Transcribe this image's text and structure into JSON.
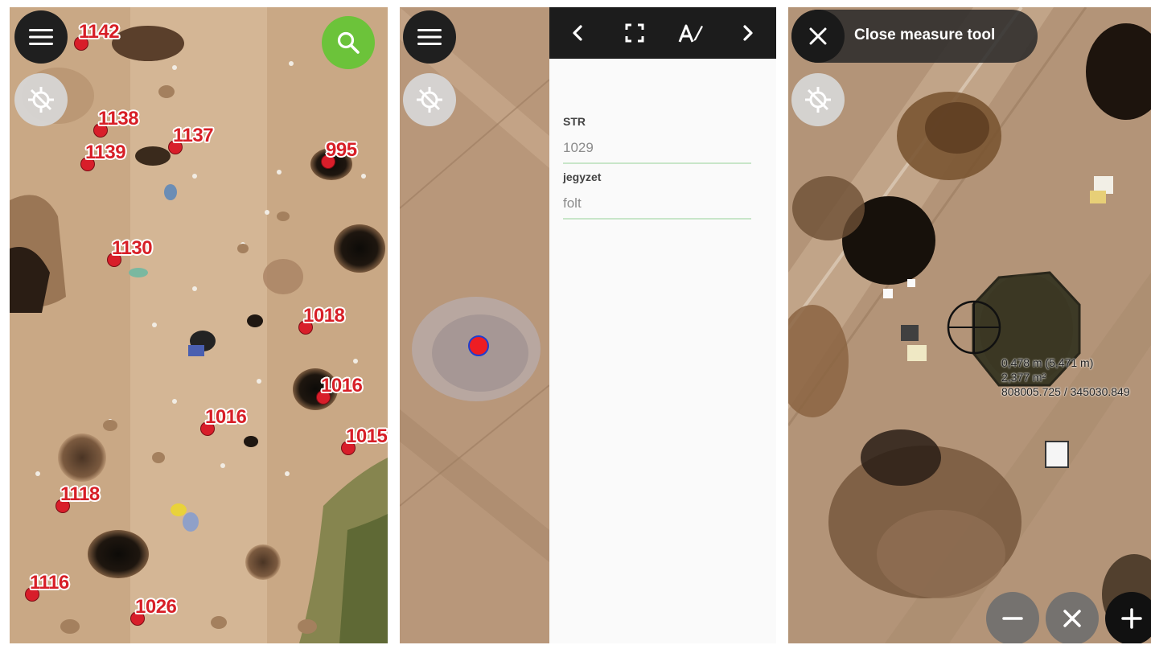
{
  "panel1": {
    "pins": [
      {
        "label": "1142"
      },
      {
        "label": "1138"
      },
      {
        "label": "1139"
      },
      {
        "label": "1137"
      },
      {
        "label": "995"
      },
      {
        "label": "1130"
      },
      {
        "label": "1018"
      },
      {
        "label": "1016"
      },
      {
        "label": "1016"
      },
      {
        "label": "1015"
      },
      {
        "label": "1118"
      },
      {
        "label": "1116"
      },
      {
        "label": "1026"
      }
    ]
  },
  "panel2": {
    "form": {
      "fields": [
        {
          "label": "STR",
          "value": "1029"
        },
        {
          "label": "jegyzet",
          "value": "folt"
        }
      ]
    }
  },
  "panel3": {
    "close_label": "Close measure tool",
    "readout": {
      "distance": "0,478 m (5,471 m)",
      "area": "2,377 m²",
      "coords": "808005.725 / 345030.849"
    }
  },
  "icons": {
    "menu": "menu-icon",
    "gps": "gps-off-icon",
    "search": "search-icon",
    "prev": "chevron-left-icon",
    "fullscreen": "fullscreen-icon",
    "edit": "edit-text-icon",
    "next": "chevron-right-icon",
    "close": "close-icon",
    "zoom_out": "minus-icon",
    "clear": "clear-icon",
    "zoom_in": "plus-icon"
  },
  "colors": {
    "pin_red": "#d81e2a",
    "search_green": "#6cc33a",
    "field_underline": "#c8e6c9",
    "dark_button": "#1f1f1f"
  }
}
